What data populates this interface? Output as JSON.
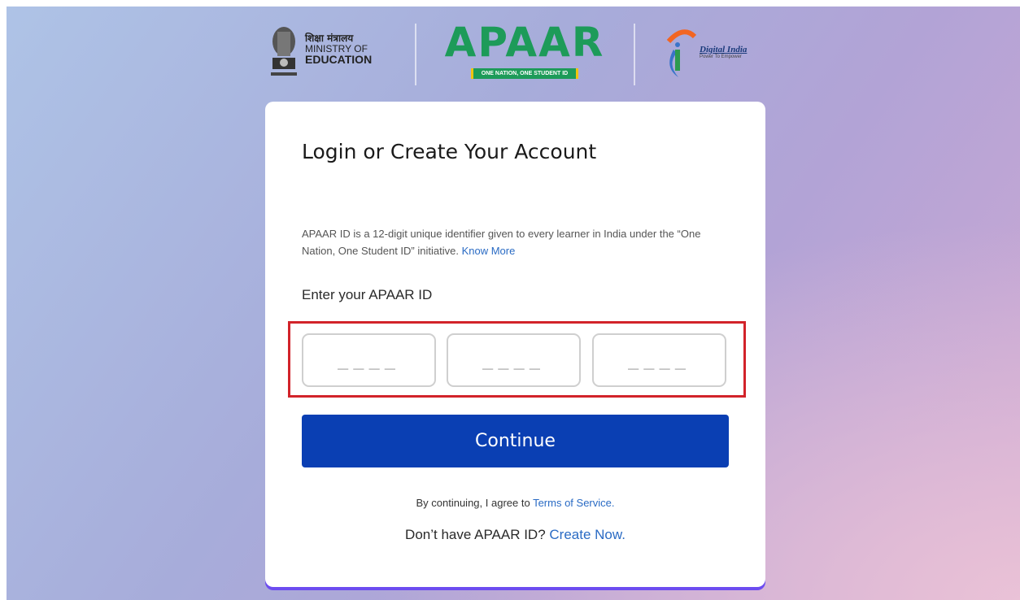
{
  "header": {
    "moe": {
      "hindi": "शिक्षा मंत्रालय",
      "line2": "MINISTRY OF",
      "line3": "EDUCATION"
    },
    "apaar": {
      "word": "APAAR",
      "tagline": "ONE NATION, ONE STUDENT ID"
    },
    "digital_india": {
      "title": "Digital India",
      "subtitle": "Power To Empower"
    }
  },
  "card": {
    "title": "Login or Create Your Account",
    "info_text": "APAAR ID is a 12-digit unique identifier given to every learner in India under the “One Nation, One Student ID” initiative.",
    "know_more": "Know More",
    "field_label": "Enter your APAAR ID",
    "segments": [
      {
        "placeholder": "____",
        "value": ""
      },
      {
        "placeholder": "____",
        "value": ""
      },
      {
        "placeholder": "____",
        "value": ""
      }
    ],
    "continue_label": "Continue",
    "terms_prefix": "By continuing, I agree to",
    "terms_link": "Terms of Service.",
    "create_prefix": "Don’t have APAAR ID?",
    "create_link": "Create Now."
  },
  "colors": {
    "accent": "#0a3fb3",
    "highlight": "#d2232a",
    "apaar_green": "#1d9b59",
    "link": "#2a6bc4"
  }
}
